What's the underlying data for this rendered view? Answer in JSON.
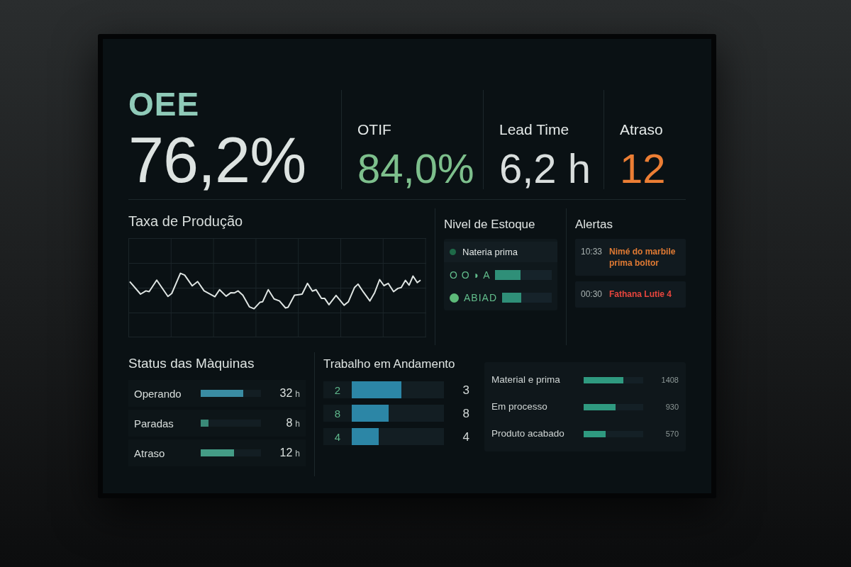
{
  "kpis": [
    {
      "kind": "primary",
      "label": "OEE",
      "value": "76,2%",
      "color": "#dde3e1"
    },
    {
      "kind": "standard",
      "label": "OTIF",
      "value": "84,0%",
      "color": "#7dbf8c"
    },
    {
      "kind": "standard",
      "label": "Lead Time",
      "value": "6,2 h",
      "color": "#d9dedd"
    },
    {
      "kind": "standard",
      "label": "Atraso",
      "value": "12",
      "color": "#ec7e34"
    }
  ],
  "production_rate": {
    "title": "Taxa de Produção"
  },
  "stock_level": {
    "title": "Nivel de Estoque",
    "items": [
      {
        "kind": "legend",
        "label": "Nateria prima",
        "color": "#1e6a48"
      },
      {
        "kind": "gauge",
        "label": "O O ◗ A",
        "level": 0.45
      },
      {
        "kind": "gauge",
        "label": "ABIAD",
        "color": "#5dba79",
        "level": 0.39
      }
    ]
  },
  "alerts": {
    "title": "Alertas",
    "items": [
      {
        "time": "10:33",
        "message": "Nimé do marbile prima boltor",
        "color": "#e07a33"
      },
      {
        "time": "00:30",
        "message": "Fathana Lutie 4",
        "color": "#e8453d"
      }
    ]
  },
  "machine_status": {
    "title": "Status das Màquinas",
    "rows": [
      {
        "label": "Operando",
        "level": 0.7,
        "value": "32",
        "unit": "h",
        "color": "#3a8ca3"
      },
      {
        "label": "Paradas",
        "level": 0.13,
        "value": "8",
        "unit": "h",
        "color": "#3a8a78"
      },
      {
        "label": "Atraso",
        "level": 0.55,
        "value": "12",
        "unit": "h",
        "color": "#449c86"
      }
    ]
  },
  "work_in_progress": {
    "title": "Trabalho em Andamento",
    "rows": [
      {
        "number": "2",
        "level": 0.54,
        "value": "3"
      },
      {
        "number": "8",
        "level": 0.4,
        "value": "8"
      },
      {
        "number": "4",
        "level": 0.29,
        "value": "4"
      }
    ]
  },
  "inventory": {
    "rows": [
      {
        "label": "Material e prima",
        "level": 0.67,
        "value": "1408"
      },
      {
        "label": "Em processo",
        "level": 0.53,
        "value": "930"
      },
      {
        "label": "Produto acabado",
        "level": 0.37,
        "value": "570"
      }
    ]
  }
}
